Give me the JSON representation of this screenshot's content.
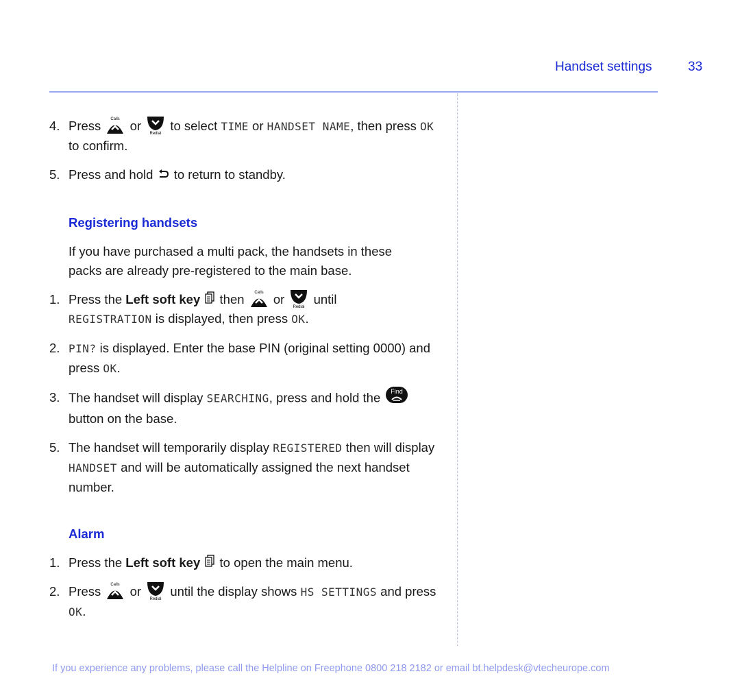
{
  "header": {
    "section_title": "Handset settings",
    "page_number": "33"
  },
  "content": {
    "step4": {
      "num": "4.",
      "t1": "Press",
      "t2": "or",
      "t3": "to select",
      "lcd1": "TIME",
      "t4": "or",
      "lcd2": "HANDSET NAME",
      "t5": ", then press",
      "lcd3": "OK",
      "t6": "to confirm."
    },
    "step5": {
      "num": "5.",
      "t1": "Press and hold",
      "t2": "to return to standby."
    },
    "registering": {
      "heading": "Registering handsets",
      "intro": "If you have purchased a multi pack, the handsets in these packs are already pre-registered to the main base.",
      "steps": [
        {
          "num": "1.",
          "t1": "Press the",
          "bold": "Left soft key",
          "t2": "then",
          "t3": "or",
          "t4": "until",
          "lcd1": "REGISTRATION",
          "t5": "is displayed, then press",
          "lcd2": "OK",
          "t6": "."
        },
        {
          "num": "2.",
          "lcd1": "PIN?",
          "t1": "is displayed. Enter the base PIN (original setting 0000) and press",
          "lcd2": "OK",
          "t2": "."
        },
        {
          "num": "3.",
          "t1": "The handset will display",
          "lcd1": "SEARCHING",
          "t2": ", press and hold the",
          "t3": "button on the base."
        },
        {
          "num": "5.",
          "t1": "The handset will temporarily display",
          "lcd1": "REGISTERED",
          "t2": "then will display",
          "lcd2": "HANDSET",
          "t3": "and will be automatically assigned the next handset number."
        }
      ]
    },
    "alarm": {
      "heading": "Alarm",
      "steps": [
        {
          "num": "1.",
          "t1": "Press the",
          "bold": "Left soft key",
          "t2": "to open the main menu."
        },
        {
          "num": "2.",
          "t1": "Press",
          "t2": "or",
          "t3": "until the display shows",
          "lcd1": "HS SETTINGS",
          "t4": "and press",
          "lcd2": "OK",
          "t5": "."
        }
      ]
    }
  },
  "icons": {
    "calls_label": "Calls",
    "redial_label": "Redial",
    "find_label": "Find"
  },
  "footer": {
    "text": "If you experience any problems, please call the Helpline on Freephone 0800 218 2182 or email bt.helpdesk@vtecheurope.com"
  },
  "colors": {
    "accent": "#1a2bd6",
    "rule": "#9aa6f2",
    "footer": "#8f9af0"
  }
}
